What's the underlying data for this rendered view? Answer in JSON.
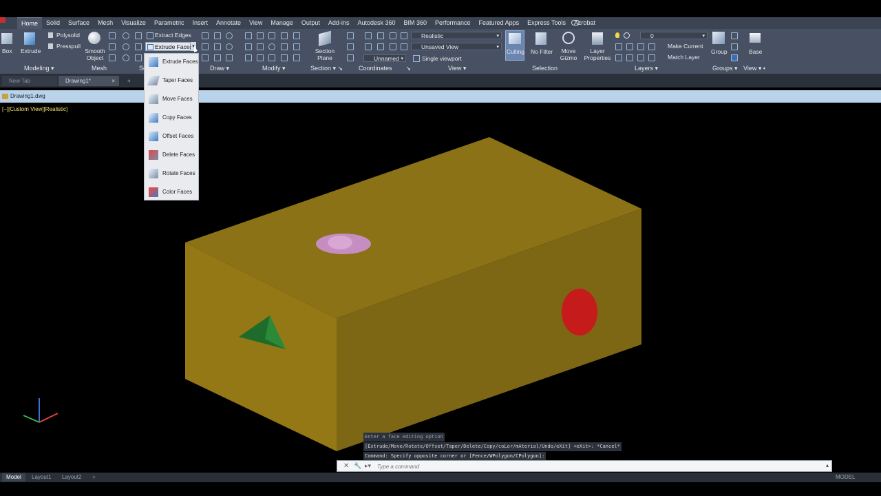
{
  "tabs": [
    "Home",
    "Solid",
    "Surface",
    "Mesh",
    "Visualize",
    "Parametric",
    "Insert",
    "Annotate",
    "View",
    "Manage",
    "Output",
    "Add-ins",
    "Autodesk 360",
    "BIM 360",
    "Performance",
    "Featured Apps",
    "Express Tools",
    "Acrobat"
  ],
  "ribbon": {
    "box": "Box",
    "extrude": "Extrude",
    "polysolid": "Polysolid",
    "presspull": "Presspull",
    "smooth_object": "Smooth Object",
    "extract_edges": "Extract Edges",
    "extrude_faces": "Extrude Faces",
    "section_plane": "Section Plane",
    "visual_style": "Realistic",
    "saved_view": "Unsaved View",
    "ucs": "Unnamed",
    "viewport": "Single viewport",
    "culling": "Culling",
    "no_filter": "No Filter",
    "move_gizmo": "Move Gizmo",
    "layer_properties": "Layer Properties",
    "layer_value": "0",
    "make_current": "Make Current",
    "match_layer": "Match Layer",
    "group": "Group",
    "base": "Base"
  },
  "panels": {
    "modeling": "Modeling",
    "mesh": "Mesh",
    "solid_partial": "So",
    "draw": "Draw",
    "modify": "Modify",
    "section": "Section",
    "coordinates": "Coordinates",
    "view": "View",
    "selection": "Selection",
    "layers": "Layers",
    "groups": "Groups",
    "view2": "View"
  },
  "doc_tabs": [
    "New Tab",
    "Drawing1*"
  ],
  "file_name": "Drawing1.dwg",
  "viewport_label": "[−][Custom View][Realistic]",
  "menu_items": [
    "Extrude Faces",
    "Taper Faces",
    "Move Faces",
    "Copy Faces",
    "Offset Faces",
    "Delete Faces",
    "Rotate Faces",
    "Color Faces"
  ],
  "command_history": [
    "Enter a face editing option",
    "[Extrude/Move/Rotate/Offset/Taper/Delete/Copy/coLor/mAterial/Undo/eXit] <eXit>: *Cancel*",
    "Command: Specify opposite corner or [Fence/WPolygon/CPolygon]:"
  ],
  "command_placeholder": "Type a command",
  "layout_tabs": [
    "Model",
    "Layout1",
    "Layout2"
  ],
  "status_right": "MODEL",
  "colors": {
    "box_top": "#8a7114",
    "box_front": "#977b16",
    "box_side": "#7e6812",
    "hole_top": "#c98fc2",
    "hole_side": "#c21a1a",
    "triangle": "#1f6b2a"
  }
}
